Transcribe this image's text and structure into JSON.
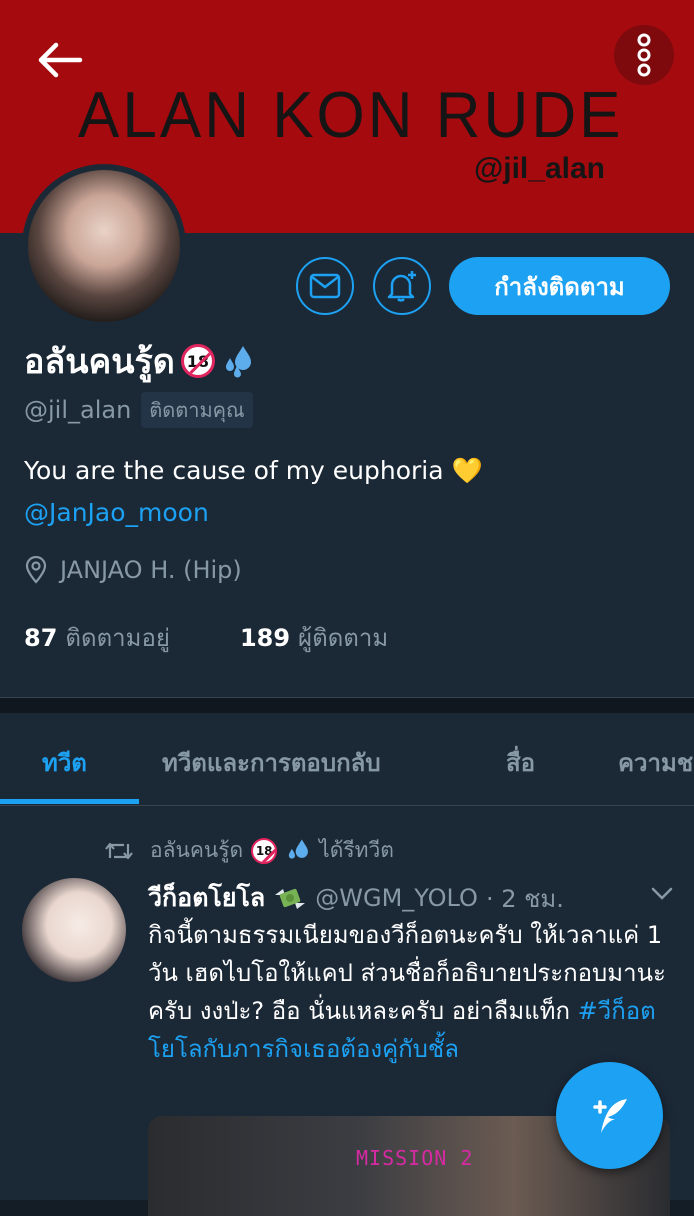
{
  "banner": {
    "title": "ALAN KON RUDE",
    "handle": "@jil_alan"
  },
  "profile": {
    "display_name": "อลันคนรู้ด",
    "badge": "18",
    "handle": "@jil_alan",
    "follows_you": "ติดตามคุณ",
    "bio_text": "You are the cause of my euphoria 💛",
    "bio_mention": "@JanJao_moon",
    "location": "JANJAO H. (Hip)",
    "following_count": "87",
    "following_label": "ติดตามอยู่",
    "followers_count": "189",
    "followers_label": "ผู้ติดตาม",
    "follow_button": "กำลังติดตาม"
  },
  "tabs": [
    {
      "label": "ทวีต"
    },
    {
      "label": "ทวีตและการตอบกลับ"
    },
    {
      "label": "สื่อ"
    },
    {
      "label": "ความช"
    }
  ],
  "tweet": {
    "retweeted_by": "อลันคนรู้ด",
    "retweeted_badge": "18",
    "retweeted_label": "ได้รีทวีต",
    "author_name": "วีก็อตโยโล",
    "author_handle": "@WGM_YOLO",
    "time": "· 2 ชม.",
    "text": "กิจนี้ตามธรรมเนียมของวีก็อตนะครับ ให้เวลาแค่ 1 วัน เฮดไบโอให้แคป ส่วนชื่อก็อธิบายประกอบมานะครับ งงป่ะ? อือ นั่นแหละครับ อย่าลืมแท็ก ",
    "hashtag": "#วีก็อตโยโลกับภารกิจเธอต้องคู่กับชั้ล",
    "media_text": "MISSION 2"
  },
  "colors": {
    "accent": "#1da1f2",
    "banner": "#a50a0f",
    "background": "#1b2836",
    "muted": "#8899a6"
  },
  "icons": [
    "back-arrow-icon",
    "more-vertical-icon",
    "mail-icon",
    "bell-plus-icon",
    "location-pin-icon",
    "retweet-icon",
    "sweat-drops-emoji",
    "money-wings-emoji",
    "chevron-down-icon",
    "compose-feather-icon"
  ]
}
